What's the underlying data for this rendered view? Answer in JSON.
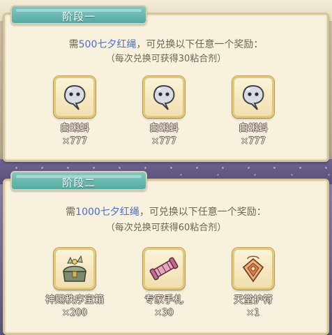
{
  "colors": {
    "tab": "#56a9a0",
    "panel": "#f7f1de",
    "highlight": "#4a6fc8",
    "text": "#6e6452"
  },
  "stages": [
    {
      "title": "阶段一",
      "rule_prefix": "需",
      "rule_highlight": "500七夕红绳",
      "rule_suffix": "，可兑换以下任意一个奖励：",
      "sub": "（每次兑换可获得30粘合剂）",
      "rewards": [
        {
          "name": "白蝌蚪",
          "qty": "×777",
          "icon": "tadpole-icon"
        },
        {
          "name": "白蝌蚪",
          "qty": "×777",
          "icon": "tadpole-icon"
        },
        {
          "name": "白蝌蚪",
          "qty": "×777",
          "icon": "tadpole-icon"
        }
      ]
    },
    {
      "title": "阶段二",
      "rule_prefix": "需",
      "rule_highlight": "1000七夕红绳",
      "rule_suffix": "，可兑换以下任意一个奖励：",
      "sub": "（每次兑换可获得60粘合剂）",
      "rewards": [
        {
          "name": "神赐秩序宝箱",
          "qty": "×200",
          "icon": "treasure-chest-icon"
        },
        {
          "name": "专家手札",
          "qty": "×30",
          "icon": "scroll-icon"
        },
        {
          "name": "天堂护符",
          "qty": "×1",
          "icon": "amulet-icon"
        }
      ]
    }
  ]
}
